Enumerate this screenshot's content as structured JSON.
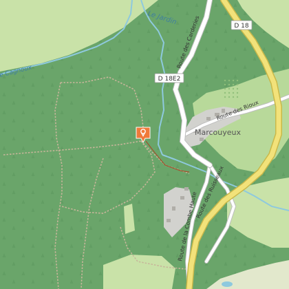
{
  "map": {
    "labels": {
      "le_jardin": "Le Jardin",
      "cagnoux": "e Cagnoux",
      "marcouyeux": "Marcouyeux",
      "route_cardeiries": "Route des Carderies",
      "route_rioux": "Route des Rioux",
      "route_ruisseaux": "Route des Ruisseaux",
      "route_combe": "Route de la Combe Haute"
    },
    "shields": {
      "d18": "D 18",
      "d18e2": "D 18E2"
    },
    "marker": {
      "icon": "location-pin-icon",
      "color": "#f07a3a"
    },
    "colors": {
      "forest": "#6aa56a",
      "meadow": "#c9e2a8",
      "water": "#8ec9de",
      "major_road": "#f2e27a",
      "road": "#ffffff",
      "settlement": "#d2d2ce",
      "trail": "#c7b59a"
    }
  }
}
